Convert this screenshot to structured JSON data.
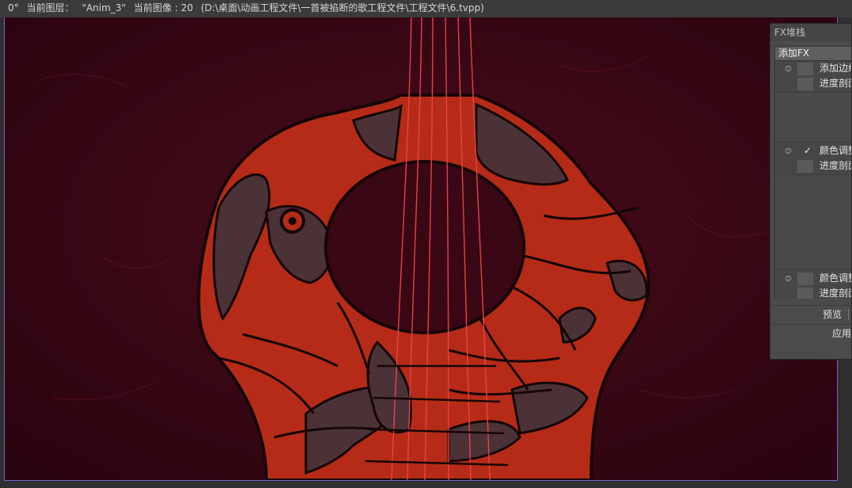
{
  "status_bar": {
    "angle": "0°",
    "layer_label": "当前图层：",
    "layer_name": "\"Anim_3\"",
    "image_label": "当前图像 : 20",
    "file_path": "(D:\\桌面\\动画工程文件\\一首被掐断的歌工程文件\\工程文件\\6.tvpp)"
  },
  "fx_panel": {
    "title": "FX堆栈",
    "add_button": "添加FX",
    "items": [
      {
        "label": "添加边缘",
        "checked": false
      },
      {
        "label": "进度剖面",
        "checked": false
      },
      {
        "label": "颜色调整",
        "checked": true
      },
      {
        "label": "进度剖面",
        "checked": false
      },
      {
        "label": "颜色调整",
        "checked": false
      },
      {
        "label": "进度剖面",
        "checked": false
      }
    ],
    "check_mark": "✓",
    "preview_label": "预览",
    "apply_label": "应用"
  },
  "colors": {
    "background_wine": "#3a0714",
    "guitar_orange": "#b52b17",
    "guitar_shadow": "#4a3236",
    "outline": "#160606",
    "strings": "#e8404a",
    "canvas_border": "#7d62c9"
  },
  "icons": {
    "fx_toggle": "minus-circle-icon",
    "fx_check": "checkmark-icon"
  }
}
